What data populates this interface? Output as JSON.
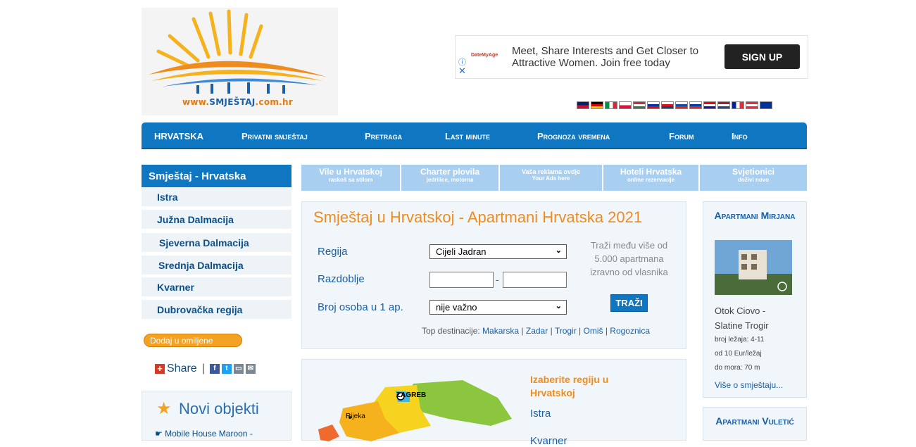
{
  "logo": {
    "prefix": "www.",
    "name": "SMJEŠTAJ",
    "suffix": ".com.hr"
  },
  "ad": {
    "brand": "DateMyAge",
    "info": "ⓘ",
    "close": "✕",
    "text": "Meet, Share Interests and Get Closer to Attractive Women. Join free today",
    "button": "SIGN UP"
  },
  "flags": [
    "gb",
    "de",
    "it",
    "pl",
    "hu",
    "si",
    "cz",
    "sk",
    "ru",
    "hr",
    "nl",
    "fr",
    "at",
    "eu"
  ],
  "nav": [
    "HRVATSKA",
    "Privatni smještaj",
    "Pretraga",
    "Last minute",
    "Prognoza vremena",
    "Forum",
    "Info"
  ],
  "sidebar": {
    "title": "Smještaj - Hrvatska",
    "items": [
      "Istra",
      "Južna Dalmacija",
      "Sjeverna Dalmacija",
      "Srednja Dalmacija",
      "Kvarner",
      "Dubrovačka regija"
    ],
    "favorite": "Dodaj u omiljene",
    "share": "Share",
    "share_sep": "|",
    "new_title": "Novi objekti",
    "new_item": "☛ Mobile House Maroon -"
  },
  "strip": [
    {
      "title": "Vile u Hrvatskoj",
      "sub": "raskoš sa stilom"
    },
    {
      "title": "Charter plovila",
      "sub": "jedrilice, motorna"
    },
    {
      "title": "Vaša reklama ovdje",
      "sub": "Your Ads here"
    },
    {
      "title": "Hoteli Hrvatska",
      "sub": "online rezervacije"
    },
    {
      "title": "Svjetionici",
      "sub": "doživi novo"
    }
  ],
  "search": {
    "title": "Smještaj u Hrvatskoj - Apartmani Hrvatska 2021",
    "region_label": "Regija",
    "region_value": "Cijeli Jadran",
    "period_label": "Razdoblje",
    "period_sep": "-",
    "persons_label": "Broj osoba u 1 ap.",
    "persons_value": "nije važno",
    "hint": "Traži među više od 5.000 apartmana izravno od vlasnika",
    "button": "TRAŽI",
    "top_label": "Top destinacije:",
    "top_dest": [
      "Makarska",
      "Zadar",
      "Trogir",
      "Omiš",
      "Rogoznica"
    ],
    "top_sep": " | "
  },
  "map": {
    "heading": "Izaberite regiju u Hrvatskoj",
    "links": [
      "Istra",
      "Kvarner"
    ],
    "city_zagreb": "ZAGREB",
    "city_rijeka": "Rijeka"
  },
  "cards": [
    {
      "title": "Apartmani Mirjana",
      "place": "Otok Ciovo - Slatine Trogir",
      "beds": "broj ležaja: 4-11",
      "price": "od 10 Eur/ležaj",
      "sea": "do mora: 70 m",
      "more": "Više o smještaju..."
    },
    {
      "title": "Apartmani Vuletić"
    }
  ],
  "colors": {
    "brand_blue": "#0f77c2",
    "accent_orange": "#f08c1e",
    "light_panel": "#f1f6fa"
  }
}
